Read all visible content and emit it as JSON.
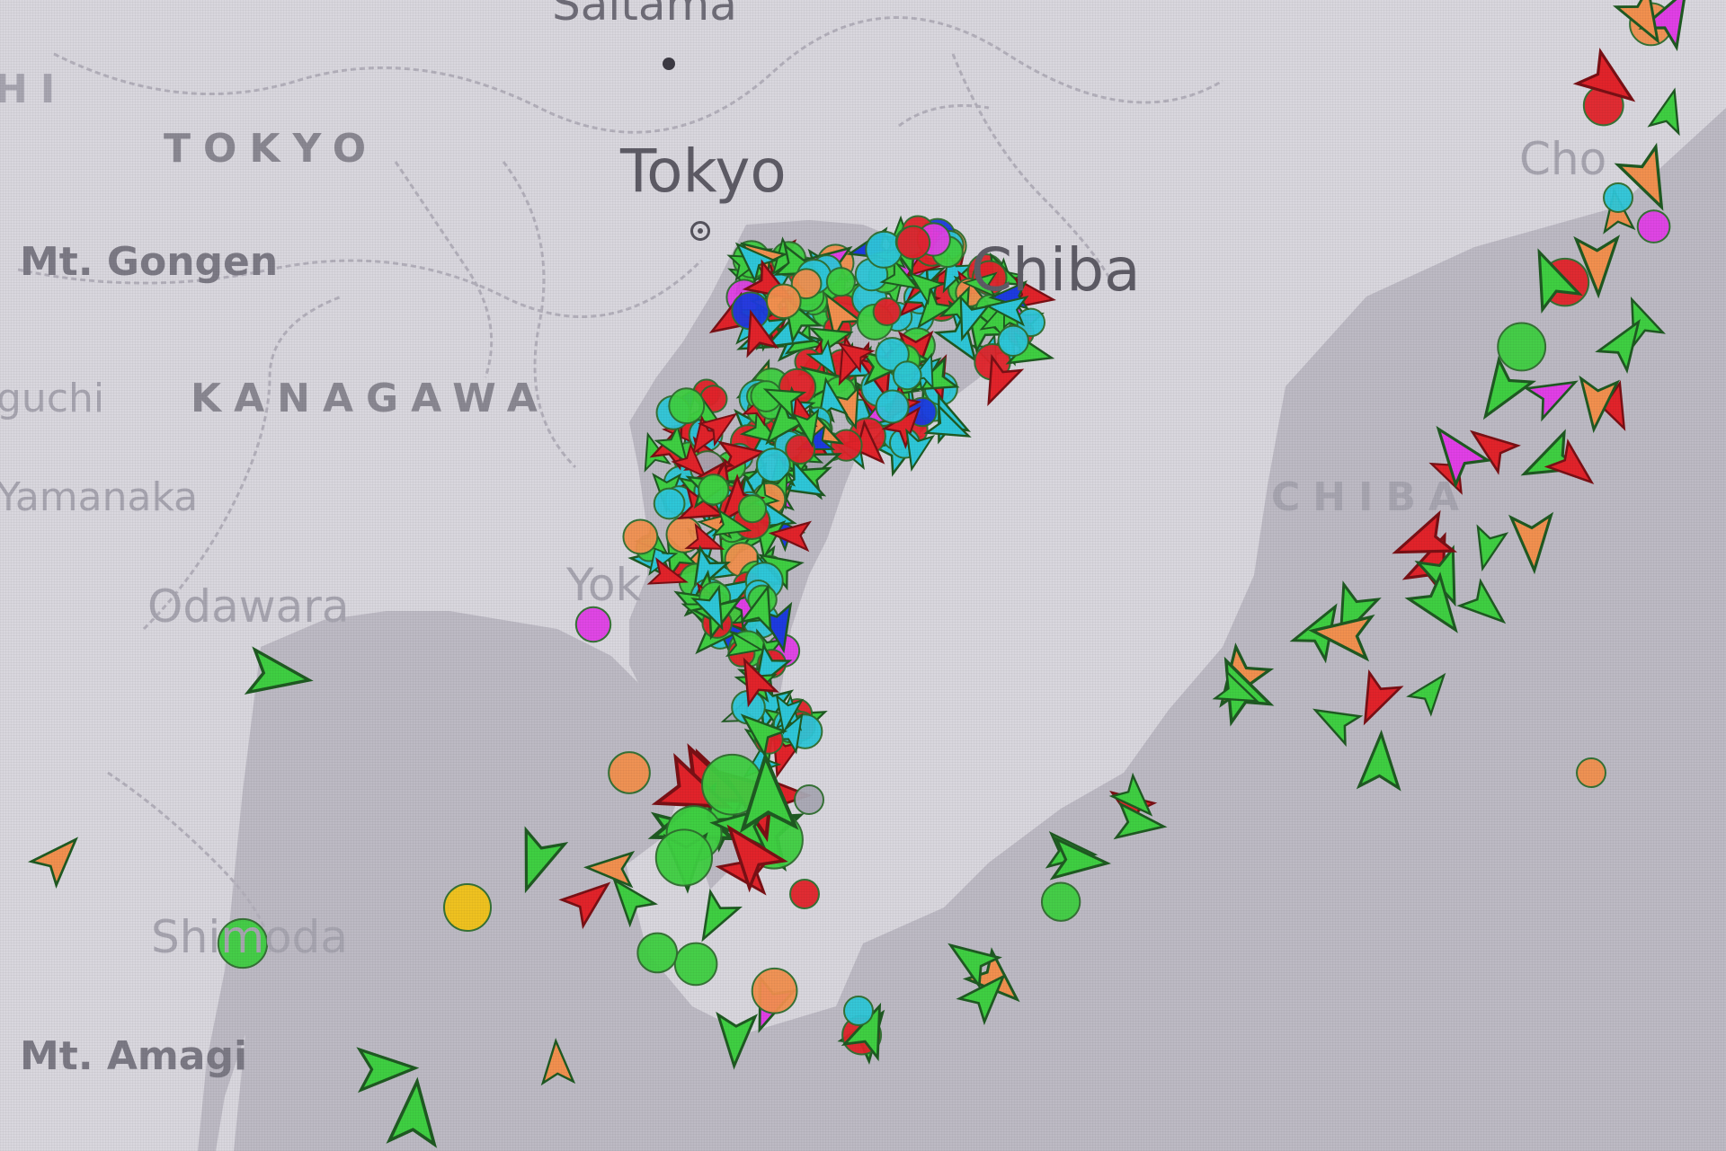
{
  "map": {
    "colors": {
      "land": "#d9d7de",
      "sea": "#bdbac4",
      "border": "#b3b0bb",
      "ship_green": "#3fcf42",
      "ship_red": "#e2232a",
      "ship_cyan": "#2ec7d9",
      "ship_magenta": "#e13fe6",
      "ship_orange": "#f2904f",
      "ship_blue": "#1d3be0",
      "ship_gray": "#a9a8b4",
      "ship_yellow": "#f2c318"
    },
    "labels": {
      "saitama": "Saitama",
      "tokyo_region": "TOKYO",
      "tokyo_city": "Tokyo",
      "mt_gongen": "Mt. Gongen",
      "guchi": "guchi",
      "kanagawa": "KANAGAWA",
      "yamanaka": "Yamanaka",
      "odawara": "Odawara",
      "yokohama": "Yok",
      "chiba_city": "Chiba",
      "chiba_region": "CHIBA",
      "choshi": "Cho",
      "shimoda": "Shimoda",
      "mt_amagi": "Mt. Amagi",
      "edge_hi": "HI"
    }
  }
}
